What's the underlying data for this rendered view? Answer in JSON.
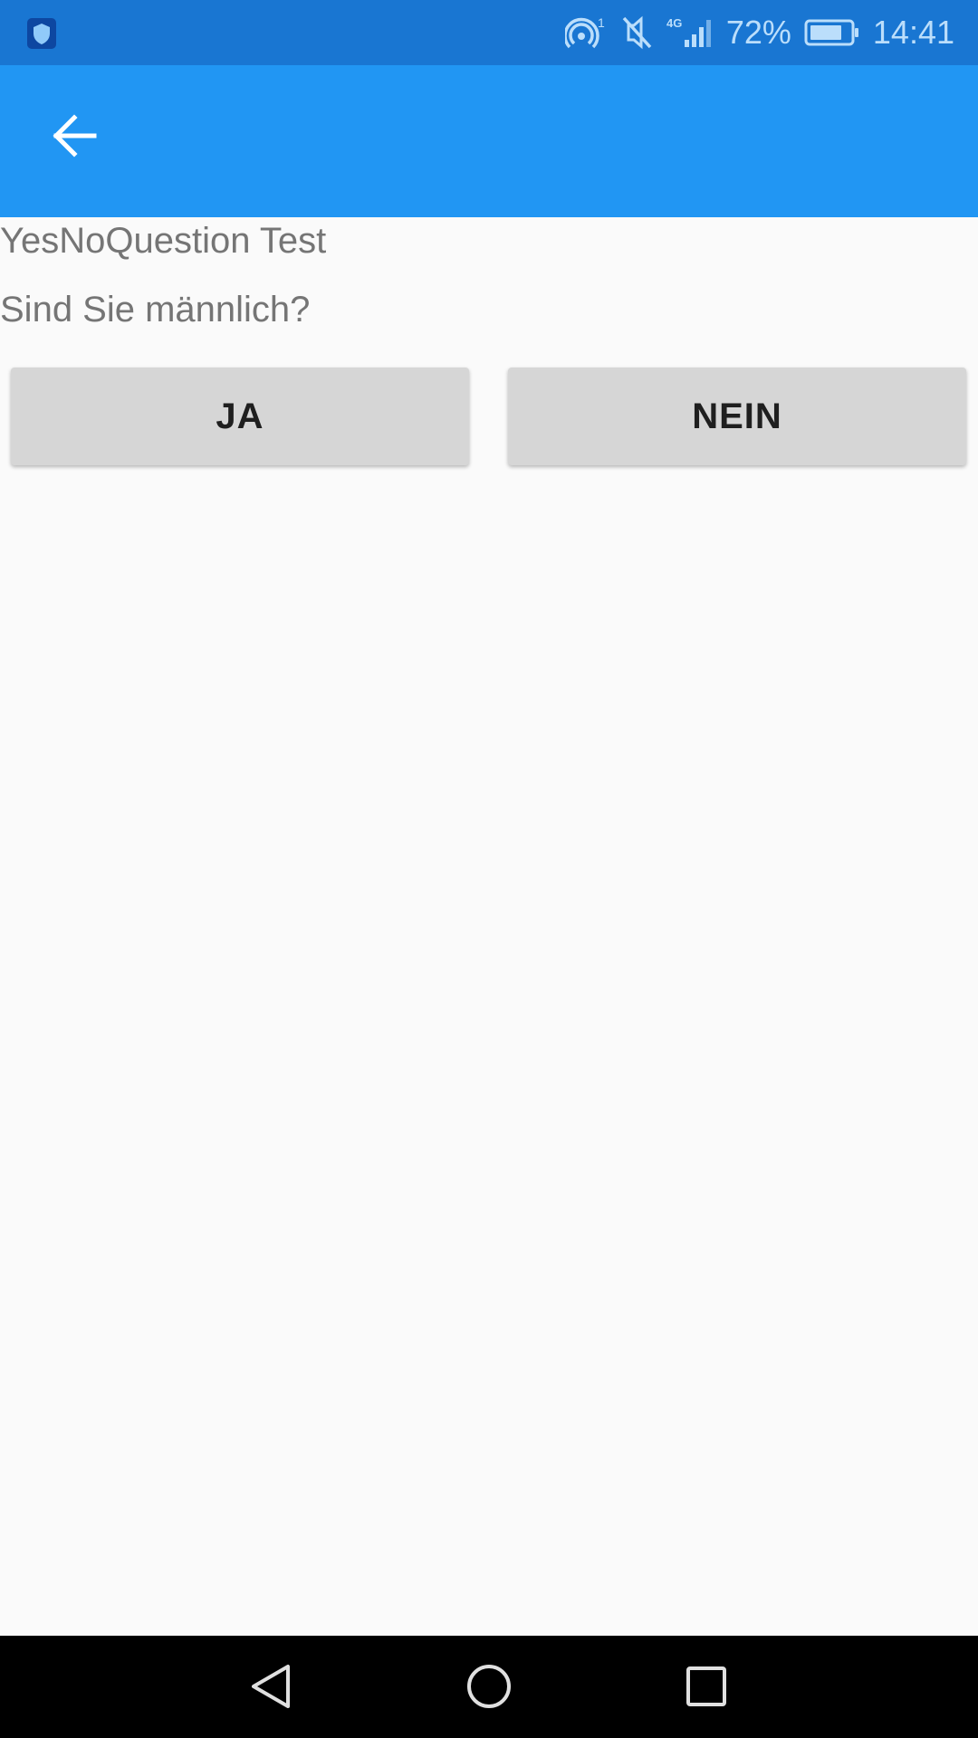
{
  "status_bar": {
    "battery_percent": "72%",
    "time": "14:41",
    "hotspot_badge": "1",
    "network_type": "4G",
    "icons": [
      "shield-icon",
      "hotspot-icon",
      "mute-icon",
      "signal-icon",
      "battery-icon"
    ],
    "colors": {
      "background": "#1976d2",
      "icon": "#bbdefb"
    }
  },
  "app_bar": {
    "back_icon": "arrow-left-icon",
    "colors": {
      "background": "#2196f3",
      "icon": "#ffffff"
    }
  },
  "content": {
    "title": "YesNoQuestion Test",
    "question": "Sind Sie männlich?",
    "buttons": {
      "yes_label": "JA",
      "no_label": "NEIN"
    }
  },
  "nav_bar": {
    "icons": [
      "nav-back-icon",
      "nav-home-icon",
      "nav-recents-icon"
    ]
  }
}
